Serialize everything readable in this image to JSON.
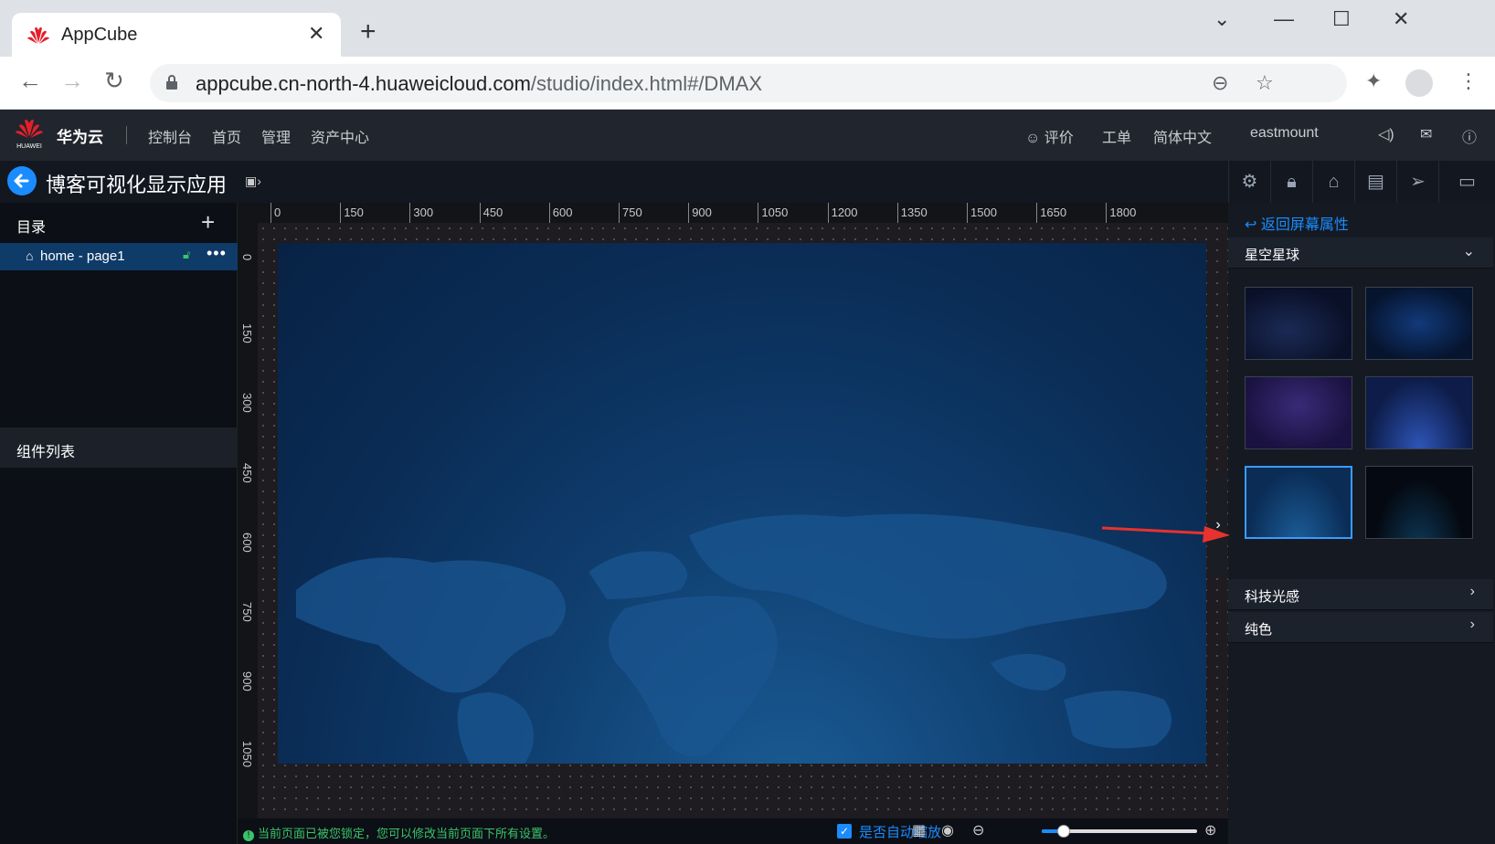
{
  "browser": {
    "tab_title": "AppCube",
    "url_host": "appcube.cn-north-4.huaweicloud.com",
    "url_path": "/studio/index.html#/DMAX"
  },
  "header": {
    "brand": "华为云",
    "logo_text": "HUAWEI",
    "nav": [
      "控制台",
      "首页",
      "管理",
      "资产中心"
    ],
    "review": "评价",
    "ticket": "工单",
    "language": "简体中文",
    "user": "eastmount"
  },
  "app": {
    "title": "博客可视化显示应用"
  },
  "left_panel": {
    "directory_label": "目录",
    "page_item": "home - page1",
    "components_label": "组件列表"
  },
  "rulers": {
    "horizontal": [
      "0",
      "150",
      "300",
      "450",
      "600",
      "750",
      "900",
      "1050",
      "1200",
      "1350",
      "1500",
      "1650",
      "1800"
    ],
    "vertical": [
      "0",
      "150",
      "300",
      "450",
      "600",
      "750",
      "900",
      "1050"
    ]
  },
  "status_bar": {
    "message": "当前页面已被您锁定，您可以修改当前页面下所有设置。",
    "auto_scale_label": "是否自动缩放",
    "auto_scale_checked": true,
    "zoom_fraction": 0.14
  },
  "right_panel": {
    "back_link": "返回屏幕属性",
    "sections": [
      {
        "label": "星空星球",
        "expanded": true
      },
      {
        "label": "科技光感",
        "expanded": false
      },
      {
        "label": "纯色",
        "expanded": false
      }
    ],
    "selected_thumbnail": 5
  },
  "colors": {
    "accent": "#1a8cff",
    "success": "#3ac46a",
    "canvas_bg": "#0a2c55",
    "arrow": "#e8322d"
  }
}
